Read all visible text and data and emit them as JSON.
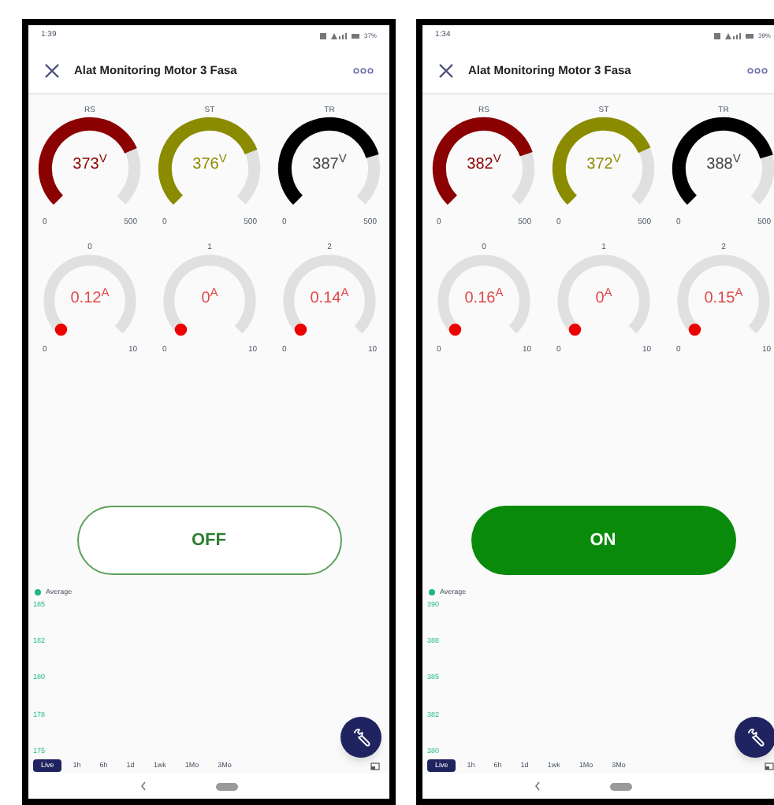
{
  "phones": [
    {
      "status_bar": {
        "time": "1:39",
        "battery": "37%"
      },
      "header": {
        "title": "Alat Monitoring Motor 3 Fasa"
      },
      "voltage_gauges": [
        {
          "label": "RS",
          "value": "373$^{V}$",
          "min": "0",
          "max": "500",
          "level": 0.746,
          "color": "#8b0000"
        },
        {
          "label": "ST",
          "value": "376$^{V}$",
          "min": "0",
          "max": "500",
          "level": 0.752,
          "color": "#8b8b00"
        },
        {
          "label": "TR",
          "value": "387$^{V}$",
          "min": "0",
          "max": "500",
          "level": 0.774,
          "color": "#000000"
        }
      ],
      "current_gauges": [
        {
          "label": "0",
          "value": "0.12$^{A}$",
          "min": "0",
          "max": "10"
        },
        {
          "label": "1",
          "value": "0$^{A}$",
          "min": "0",
          "max": "10"
        },
        {
          "label": "2",
          "value": "0.14$^{A}$",
          "min": "0",
          "max": "10"
        }
      ],
      "power_button": {
        "label": "OFF",
        "on": false
      },
      "chart": {
        "legend": "Average",
        "y_axis_labels": [
          "185",
          "182",
          "180",
          "178",
          "175"
        ]
      },
      "time_ranges": [
        {
          "label": "Live",
          "selected": true
        },
        {
          "label": "1h",
          "selected": false
        },
        {
          "label": "6h",
          "selected": false
        },
        {
          "label": "1d",
          "selected": false
        },
        {
          "label": "1wk",
          "selected": false
        },
        {
          "label": "1Mo",
          "selected": false
        },
        {
          "label": "3Mo",
          "selected": false
        }
      ]
    },
    {
      "status_bar": {
        "time": "1:34",
        "battery": "39%"
      },
      "header": {
        "title": "Alat Monitoring Motor 3 Fasa"
      },
      "voltage_gauges": [
        {
          "label": "RS",
          "value": "382$^{V}$",
          "min": "0",
          "max": "500",
          "level": 0.764,
          "color": "#8b0000"
        },
        {
          "label": "ST",
          "value": "372$^{V}$",
          "min": "0",
          "max": "500",
          "level": 0.744,
          "color": "#8b8b00"
        },
        {
          "label": "TR",
          "value": "388$^{V}$",
          "min": "0",
          "max": "500",
          "level": 0.776,
          "color": "#000000"
        }
      ],
      "current_gauges": [
        {
          "label": "0",
          "value": "0.16$^{A}$",
          "min": "0",
          "max": "10"
        },
        {
          "label": "1",
          "value": "0$^{A}$",
          "min": "0",
          "max": "10"
        },
        {
          "label": "2",
          "value": "0.15$^{A}$",
          "min": "0",
          "max": "10"
        }
      ],
      "power_button": {
        "label": "ON",
        "on": true
      },
      "chart": {
        "legend": "Average",
        "y_axis_labels": [
          "390",
          "388",
          "385",
          "382",
          "380"
        ]
      },
      "time_ranges": [
        {
          "label": "Live",
          "selected": true
        },
        {
          "label": "1h",
          "selected": false
        },
        {
          "label": "6h",
          "selected": false
        },
        {
          "label": "1d",
          "selected": false
        },
        {
          "label": "1wk",
          "selected": false
        },
        {
          "label": "1Mo",
          "selected": false
        },
        {
          "label": "3Mo",
          "selected": false
        }
      ]
    }
  ]
}
